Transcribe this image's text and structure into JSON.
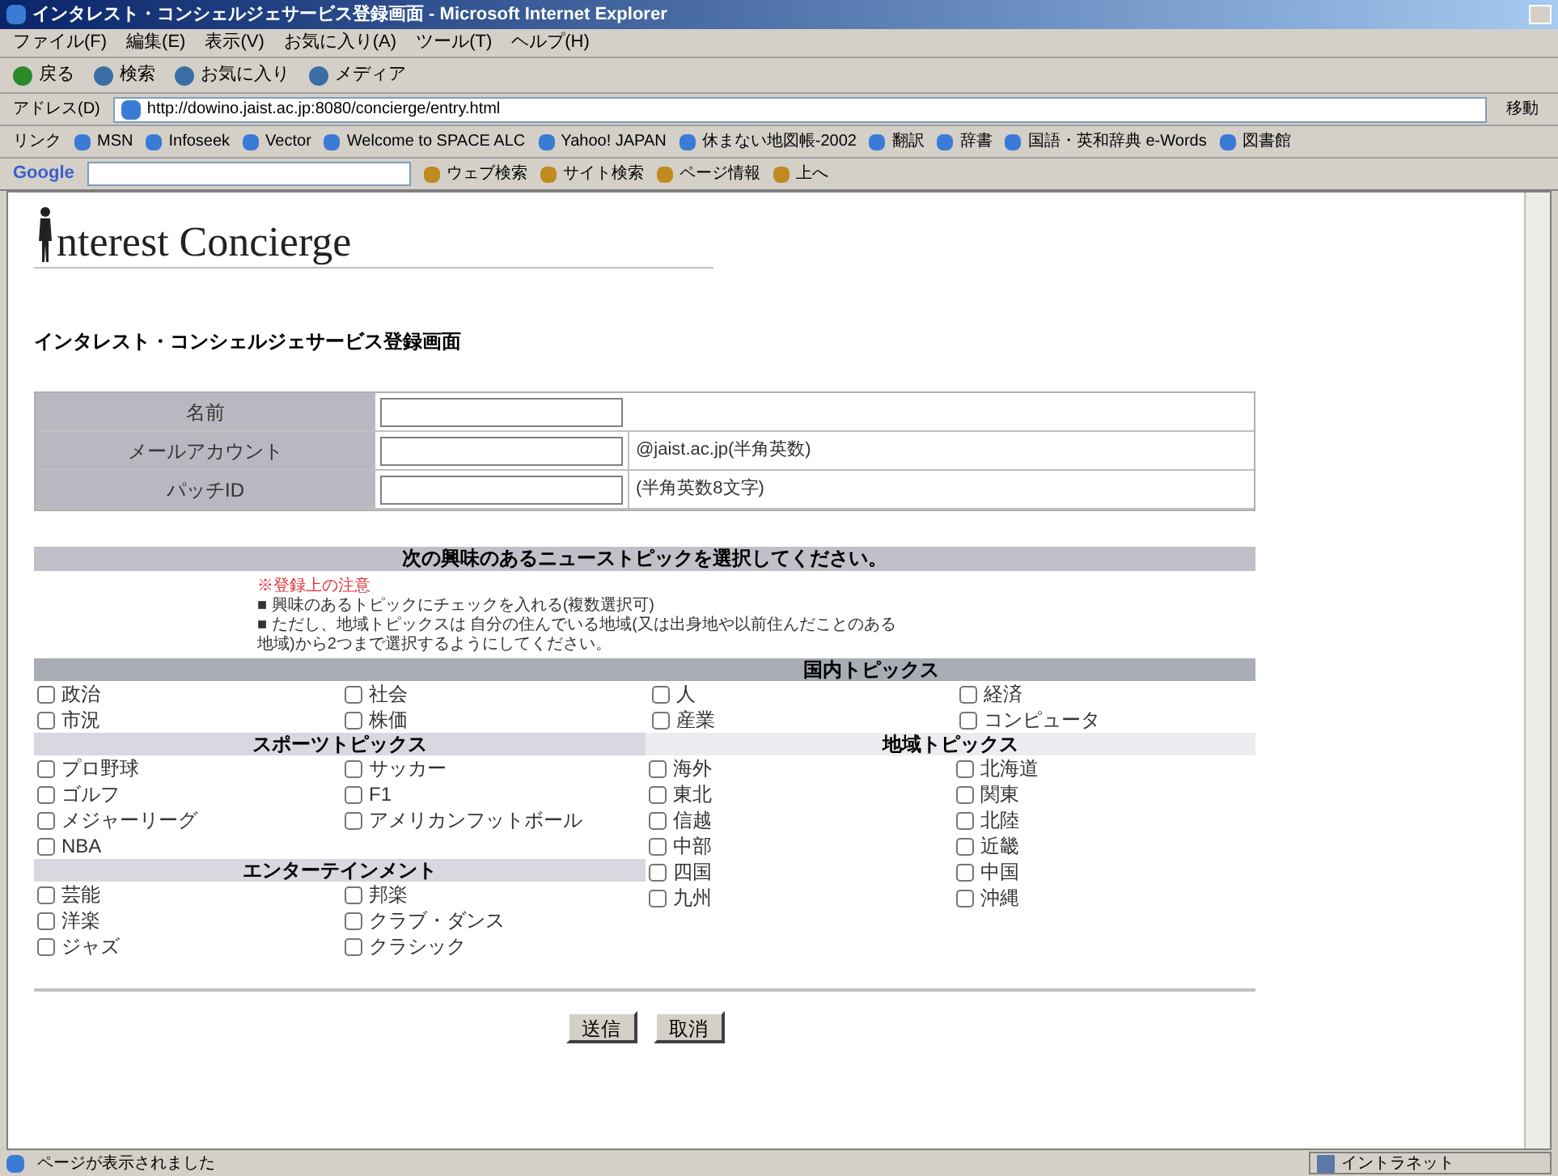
{
  "window": {
    "title": "インタレスト・コンシェルジェサービス登録画面 - Microsoft Internet Explorer"
  },
  "menu": [
    "ファイル(F)",
    "編集(E)",
    "表示(V)",
    "お気に入り(A)",
    "ツール(T)",
    "ヘルプ(H)"
  ],
  "toolbar": [
    "戻る",
    "検索",
    "お気に入り",
    "メディア"
  ],
  "address": {
    "label": "アドレス(D)",
    "value": "http://dowino.jaist.ac.jp:8080/concierge/entry.html",
    "go": "移動"
  },
  "links": {
    "label": "リンク",
    "items": [
      "MSN",
      "Infoseek",
      "Vector",
      "Welcome to SPACE ALC",
      "Yahoo! JAPAN",
      "休まない地図帳-2002",
      "翻訳",
      "辞書",
      "国語・英和辞典 e-Words",
      "図書館"
    ]
  },
  "google_bar": {
    "logo": "Google",
    "buttons": [
      "ウェブ検索",
      "サイト検索",
      "ページ情報",
      "上へ"
    ]
  },
  "page": {
    "logo": "nterest Concierge",
    "heading": "インタレスト・コンシェルジェサービス登録画面",
    "form": [
      {
        "label": "名前"
      },
      {
        "label": "メールアカウント",
        "hint": "@jaist.ac.jp(半角英数)"
      },
      {
        "label": "パッチID",
        "hint": "(半角英数8文字)"
      }
    ],
    "topic_header": "次の興味のあるニューストピックを選択してください。",
    "notice_title": "※登録上の注意",
    "notices": [
      "■ 興味のあるトピックにチェックを入れる(複数選択可)",
      "■ ただし、地域トピックスは 自分の住んでいる地域(又は出身地や以前住んだことのある",
      "地域)から2つまで選択するようにしてください。"
    ],
    "domestic": {
      "title": "国内トピックス",
      "items": [
        {
          "label": "政治",
          "checked": false
        },
        {
          "label": "社会",
          "checked": false
        },
        {
          "label": "人",
          "checked": false
        },
        {
          "label": "経済",
          "checked": false
        },
        {
          "label": "市況",
          "checked": false
        },
        {
          "label": "株価",
          "checked": false
        },
        {
          "label": "産業",
          "checked": false
        },
        {
          "label": "コンピュータ",
          "checked": false
        }
      ]
    },
    "sports": {
      "title": "スポーツトピックス",
      "items": [
        {
          "label": "プロ野球",
          "checked": false
        },
        {
          "label": "サッカー",
          "checked": false
        },
        {
          "label": "ゴルフ",
          "checked": false
        },
        {
          "label": "F1",
          "checked": false
        },
        {
          "label": "メジャーリーグ",
          "checked": false
        },
        {
          "label": "アメリカンフットボール",
          "checked": false
        },
        {
          "label": "NBA",
          "checked": false
        }
      ]
    },
    "entertainment": {
      "title": "エンターテインメント",
      "items": [
        {
          "label": "芸能",
          "checked": false
        },
        {
          "label": "邦楽",
          "checked": false
        },
        {
          "label": "洋楽",
          "checked": false
        },
        {
          "label": "クラブ・ダンス",
          "checked": false
        },
        {
          "label": "ジャズ",
          "checked": false
        },
        {
          "label": "クラシック",
          "checked": false
        }
      ]
    },
    "region": {
      "title": "地域トピックス",
      "items": [
        {
          "label": "海外",
          "checked": false
        },
        {
          "label": "北海道",
          "checked": false
        },
        {
          "label": "東北",
          "checked": false
        },
        {
          "label": "関東",
          "checked": false
        },
        {
          "label": "信越",
          "checked": false
        },
        {
          "label": "北陸",
          "checked": false
        },
        {
          "label": "中部",
          "checked": false
        },
        {
          "label": "近畿",
          "checked": false
        },
        {
          "label": "四国",
          "checked": false
        },
        {
          "label": "中国",
          "checked": false
        },
        {
          "label": "九州",
          "checked": false
        },
        {
          "label": "沖縄",
          "checked": false
        }
      ]
    },
    "buttons": [
      "送信",
      "取消"
    ]
  },
  "status_bar": {
    "text": "ページが表示されました",
    "zone": "イントラネット"
  }
}
